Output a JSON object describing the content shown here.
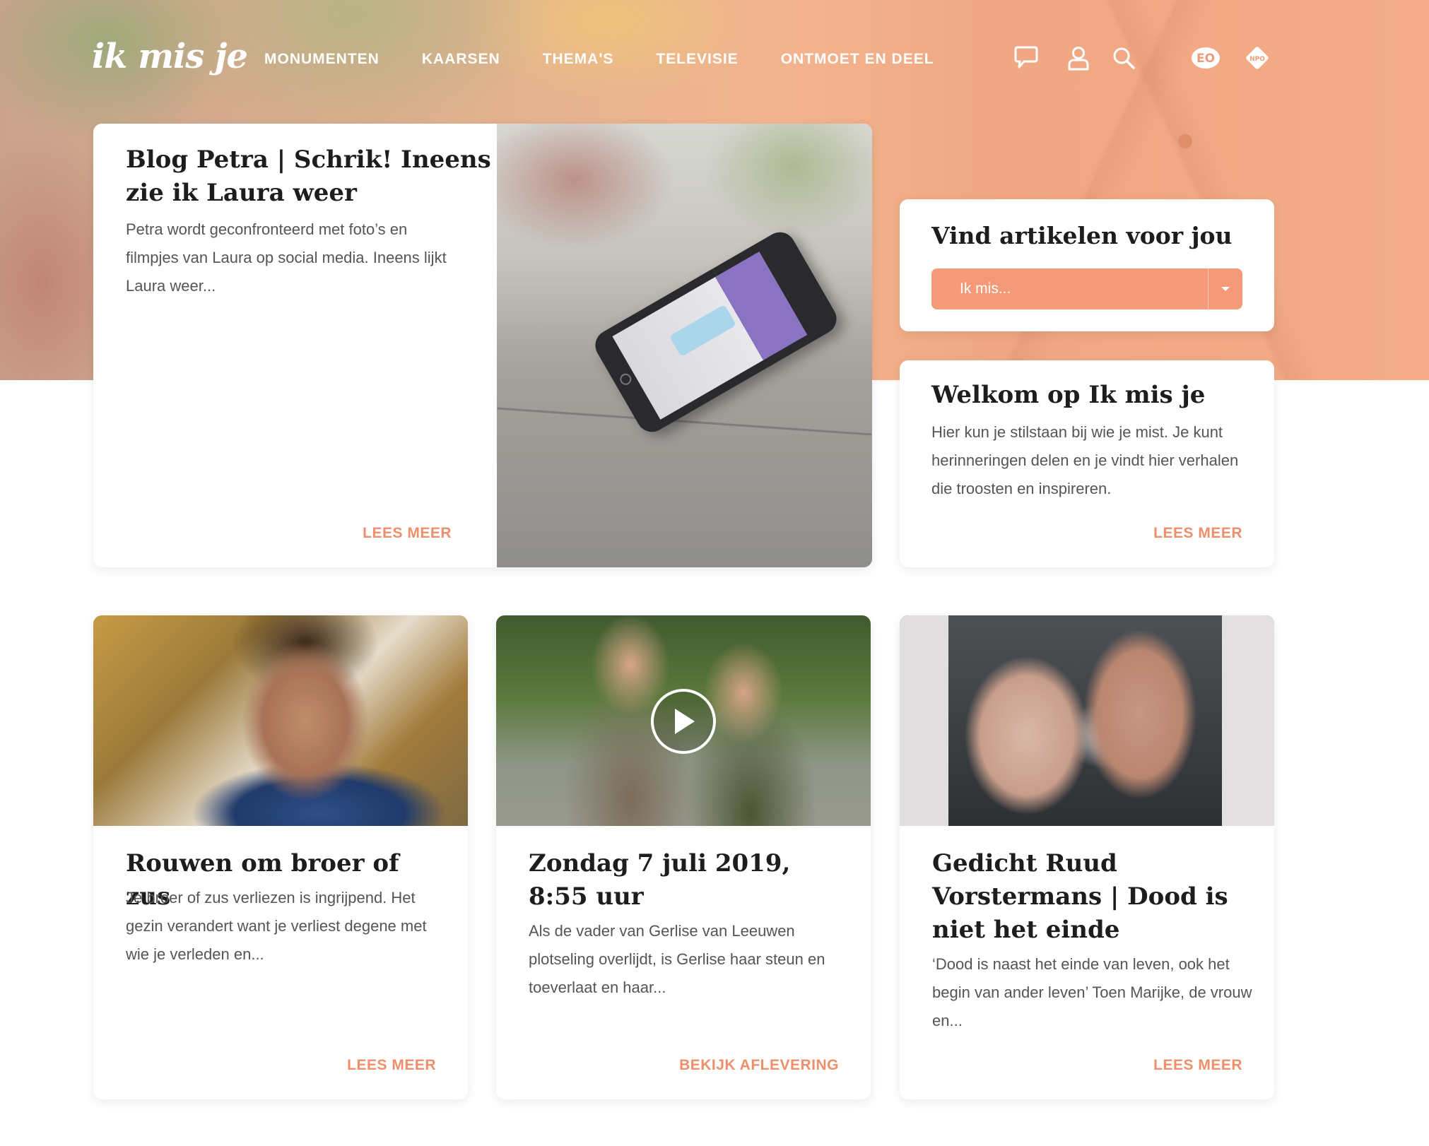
{
  "header": {
    "logo_text": "ik mis je",
    "nav": [
      {
        "label": "MONUMENTEN"
      },
      {
        "label": "KAARSEN"
      },
      {
        "label": "THEMA'S"
      },
      {
        "label": "TELEVISIE"
      },
      {
        "label": "ONTMOET EN DEEL"
      }
    ],
    "icons": [
      "chat-icon",
      "user-icon",
      "search-icon",
      "eo-logo",
      "npo-logo"
    ],
    "eo_logo_text": "EO",
    "npo_logo_text": "NPO"
  },
  "featured": {
    "title": "Blog Petra | Schrik! Ineens zie ik Laura weer",
    "excerpt": "Petra wordt geconfronteerd met foto’s en filmpjes van Laura op social media. Ineens lijkt Laura weer...",
    "link": "LEES MEER"
  },
  "find": {
    "title": "Vind artikelen voor jou",
    "select_value": "Ik mis..."
  },
  "welcome": {
    "title": "Welkom op Ik mis je",
    "text": "Hier kun je stilstaan bij wie je mist. Je kunt herinneringen delen en je vindt hier verhalen die troosten en inspireren.",
    "link": "LEES MEER"
  },
  "cards": [
    {
      "title": "Rouwen om broer of zus",
      "excerpt": "Je broer of zus verliezen is ingrijpend. Het gezin verandert want je verliest degene met wie je verleden en...",
      "link": "LEES MEER"
    },
    {
      "title": "Zondag 7 juli 2019, 8:55 uur",
      "excerpt": "Als de vader van Gerlise van Leeuwen plotseling overlijdt, is Gerlise haar steun en toeverlaat en haar...",
      "link": "BEKIJK AFLEVERING"
    },
    {
      "title": "Gedicht Ruud Vorstermans | Dood is niet het einde",
      "excerpt": "‘Dood is naast het einde van leven, ook het begin van ander leven’ Toen Marijke, de vrouw en...",
      "link": "LEES MEER"
    }
  ],
  "colors": {
    "accent": "#ee8f6c",
    "select_bg": "#f59a78",
    "title": "#1d1d1d"
  }
}
